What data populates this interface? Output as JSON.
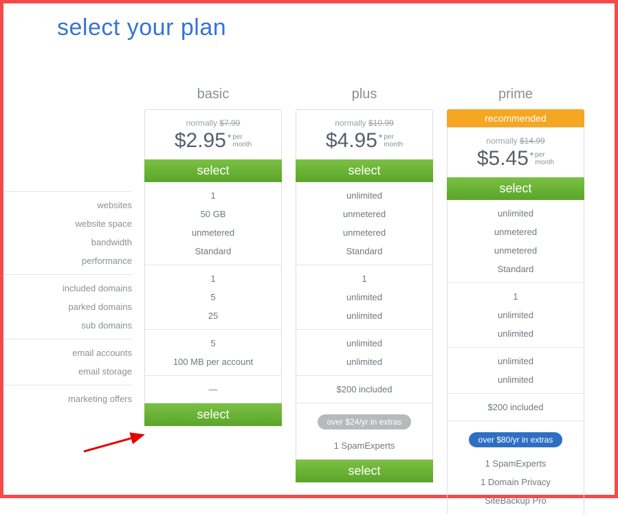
{
  "title": "select your plan",
  "labels": {
    "g1": [
      "websites",
      "website space",
      "bandwidth",
      "performance"
    ],
    "g2": [
      "included domains",
      "parked domains",
      "sub domains"
    ],
    "g3": [
      "email accounts",
      "email storage"
    ],
    "g4": [
      "marketing offers"
    ]
  },
  "plans": {
    "basic": {
      "name": "basic",
      "normally_label": "normally",
      "normally_price": "$7.99",
      "price": "$2.95",
      "per1": "per",
      "per2": "month",
      "select": "select",
      "g1": [
        "1",
        "50 GB",
        "unmetered",
        "Standard"
      ],
      "g2": [
        "1",
        "5",
        "25"
      ],
      "g3": [
        "5",
        "100 MB per account"
      ],
      "g4": [
        "—"
      ],
      "bottom_select": "select"
    },
    "plus": {
      "name": "plus",
      "normally_label": "normally",
      "normally_price": "$10.99",
      "price": "$4.95",
      "per1": "per",
      "per2": "month",
      "select": "select",
      "g1": [
        "unlimited",
        "unmetered",
        "unmetered",
        "Standard"
      ],
      "g2": [
        "1",
        "unlimited",
        "unlimited"
      ],
      "g3": [
        "unlimited",
        "unlimited"
      ],
      "g4": [
        "$200 included"
      ],
      "extras_pill": "over $24/yr in extras",
      "extras_list": [
        "1 SpamExperts"
      ],
      "bottom_select": "select"
    },
    "prime": {
      "name": "prime",
      "recommended": "recommended",
      "normally_label": "normally",
      "normally_price": "$14.99",
      "price": "$5.45",
      "per1": "per",
      "per2": "month",
      "select": "select",
      "g1": [
        "unlimited",
        "unmetered",
        "unmetered",
        "Standard"
      ],
      "g2": [
        "1",
        "unlimited",
        "unlimited"
      ],
      "g3": [
        "unlimited",
        "unlimited"
      ],
      "g4": [
        "$200 included"
      ],
      "extras_pill": "over $80/yr in extras",
      "extras_list": [
        "1 SpamExperts",
        "1 Domain Privacy",
        "SiteBackup Pro"
      ]
    }
  }
}
